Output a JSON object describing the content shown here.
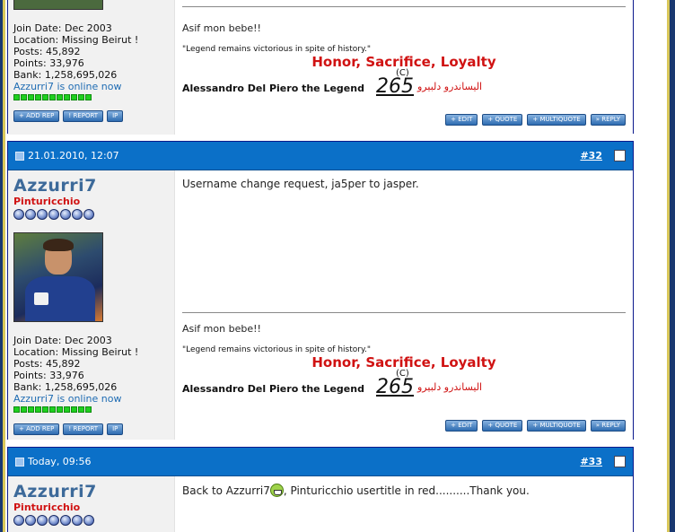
{
  "posts": [
    {
      "partial_top": true,
      "user": {
        "join": "Join Date: Dec 2003",
        "location": "Location: Missing Beirut !",
        "posts": "Posts: 45,892",
        "points": "Points: 33,976",
        "bank": "Bank: 1,258,695,026",
        "online": "Azzurri7 is online now"
      },
      "signature": {
        "line1": "Asif mon bebe!!",
        "quote": "\"Legend remains victorious in spite of history.\"",
        "honor": "Honor, Sacrifice, Loyalty",
        "legend": "Alessandro Del Piero the Legend",
        "number": "265",
        "copyright": "(C)",
        "arabic": "اليساندرو دلبيرو"
      }
    },
    {
      "date": "21.01.2010, 12:07",
      "number": "#32",
      "user": {
        "name": "Azzurri7",
        "title": "Pinturicchio",
        "join": "Join Date: Dec 2003",
        "location": "Location: Missing Beirut !",
        "posts": "Posts: 45,892",
        "points": "Points: 33,976",
        "bank": "Bank: 1,258,695,026",
        "online": "Azzurri7 is online now"
      },
      "message": "Username change request, ja5per to jasper.",
      "signature": {
        "line1": "Asif mon bebe!!",
        "quote": "\"Legend remains victorious in spite of history.\"",
        "honor": "Honor, Sacrifice, Loyalty",
        "legend": "Alessandro Del Piero the Legend",
        "number": "265",
        "copyright": "(C)",
        "arabic": "اليساندرو دلبيرو"
      }
    },
    {
      "date": "Today, 09:56",
      "number": "#33",
      "user": {
        "name": "Azzurri7",
        "title": "Pinturicchio"
      },
      "message_before": "Back to Azzurri7",
      "message_after": ", Pinturicchio usertitle in red..........Thank you."
    }
  ],
  "buttons": {
    "add_rep": "+ ADD REP",
    "report": "! REPORT",
    "ip": "IP",
    "edit": "+ EDIT",
    "quote": "+ QUOTE",
    "multiquote": "+ MULTIQUOTE",
    "reply": "» REPLY"
  },
  "colors": {
    "header_blue": "#0b70c8",
    "title_red": "#d01212",
    "username_blue": "#3d6a9a"
  }
}
